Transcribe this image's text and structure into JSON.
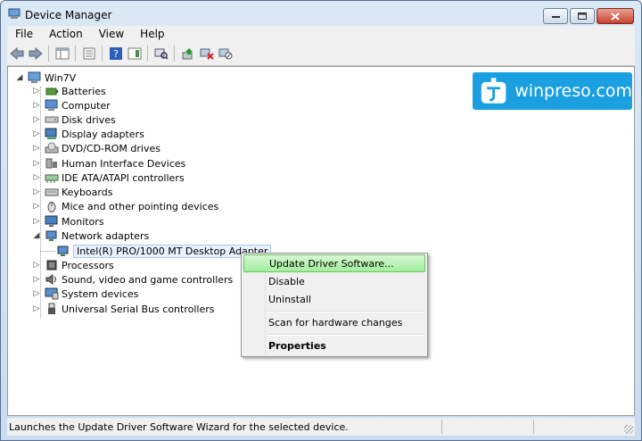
{
  "window": {
    "title": "Device Manager"
  },
  "menu": [
    "File",
    "Action",
    "View",
    "Help"
  ],
  "toolbar_icons": [
    "back-icon",
    "forward-icon",
    "show-hide-console-tree-icon",
    "properties-icon",
    "help-icon",
    "action-pane-icon",
    "scan-hardware-icon",
    "update-driver-icon",
    "uninstall-icon",
    "disable-icon"
  ],
  "tree": {
    "root": "Win7V",
    "categories": [
      {
        "label": "Batteries",
        "icon": "battery-icon"
      },
      {
        "label": "Computer",
        "icon": "computer-icon"
      },
      {
        "label": "Disk drives",
        "icon": "disk-drive-icon"
      },
      {
        "label": "Display adapters",
        "icon": "display-adapter-icon"
      },
      {
        "label": "DVD/CD-ROM drives",
        "icon": "dvd-drive-icon"
      },
      {
        "label": "Human Interface Devices",
        "icon": "hid-icon"
      },
      {
        "label": "IDE ATA/ATAPI controllers",
        "icon": "ide-controller-icon"
      },
      {
        "label": "Keyboards",
        "icon": "keyboard-icon"
      },
      {
        "label": "Mice and other pointing devices",
        "icon": "mouse-icon"
      },
      {
        "label": "Monitors",
        "icon": "monitor-icon"
      },
      {
        "label": "Network adapters",
        "icon": "network-adapter-icon",
        "expanded": true
      },
      {
        "label": "Processors",
        "icon": "processor-icon"
      },
      {
        "label": "Sound, video and game controllers",
        "icon": "sound-icon"
      },
      {
        "label": "System devices",
        "icon": "system-device-icon"
      },
      {
        "label": "Universal Serial Bus controllers",
        "icon": "usb-icon"
      }
    ],
    "selected_device": "Intel(R) PRO/1000 MT Desktop Adapter"
  },
  "watermark": {
    "text": "winpreso.com"
  },
  "context_menu": {
    "items": [
      "Update Driver Software...",
      "Disable",
      "Uninstall",
      "Scan for hardware changes",
      "Properties"
    ],
    "highlighted": "Update Driver Software..."
  },
  "status": {
    "text": "Launches the Update Driver Software Wizard for the selected device."
  },
  "colors": {
    "highlight": "#a2ed9c",
    "logo_bg": "#1a9fe0",
    "frame": "#c9dcef"
  }
}
